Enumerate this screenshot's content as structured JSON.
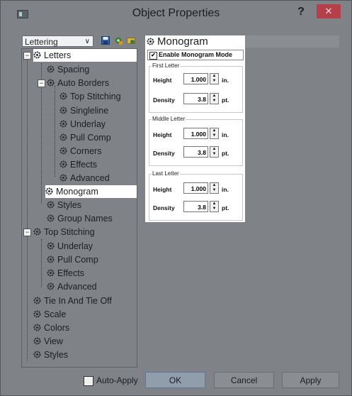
{
  "window": {
    "title": "Object Properties",
    "help_label": "?",
    "close_label": "✕"
  },
  "left_pane": {
    "dropdown_value": "Lettering",
    "toolbar_icons": [
      "save-icon",
      "tree-gear-icon",
      "folder-gear-icon"
    ]
  },
  "tree": {
    "letters": "Letters",
    "spacing": "Spacing",
    "auto_borders": "Auto Borders",
    "top_stitching": "Top Stitching",
    "singleline": "Singleline",
    "underlay": "Underlay",
    "pull_comp": "Pull Comp",
    "corners": "Corners",
    "effects": "Effects",
    "advanced": "Advanced",
    "monogram": "Monogram",
    "styles": "Styles",
    "group_names": "Group Names",
    "top_stitching_root": "Top Stitching",
    "ts_underlay": "Underlay",
    "ts_pull_comp": "Pull Comp",
    "ts_effects": "Effects",
    "ts_advanced": "Advanced",
    "tie_in": "Tie In And Tie Off",
    "scale": "Scale",
    "colors": "Colors",
    "view": "View",
    "styles_root": "Styles"
  },
  "monogram": {
    "header": "Monogram",
    "enable_label": "Enable Monogram Mode",
    "enable_checked": true,
    "first": {
      "title": "First Letter",
      "height_label": "Height",
      "height_value": "1.000",
      "height_unit": "in.",
      "density_label": "Density",
      "density_value": "3.8",
      "density_unit": "pt."
    },
    "middle": {
      "title": "Middle Letter",
      "height_label": "Height",
      "height_value": "1.000",
      "height_unit": "in.",
      "density_label": "Density",
      "density_value": "3.8",
      "density_unit": "pt."
    },
    "last": {
      "title": "Last Letter",
      "height_label": "Height",
      "height_value": "1.000",
      "height_unit": "in.",
      "density_label": "Density",
      "density_value": "3.8",
      "density_unit": "pt."
    }
  },
  "footer": {
    "auto_apply": "Auto-Apply",
    "ok": "OK",
    "cancel": "Cancel",
    "apply": "Apply"
  }
}
